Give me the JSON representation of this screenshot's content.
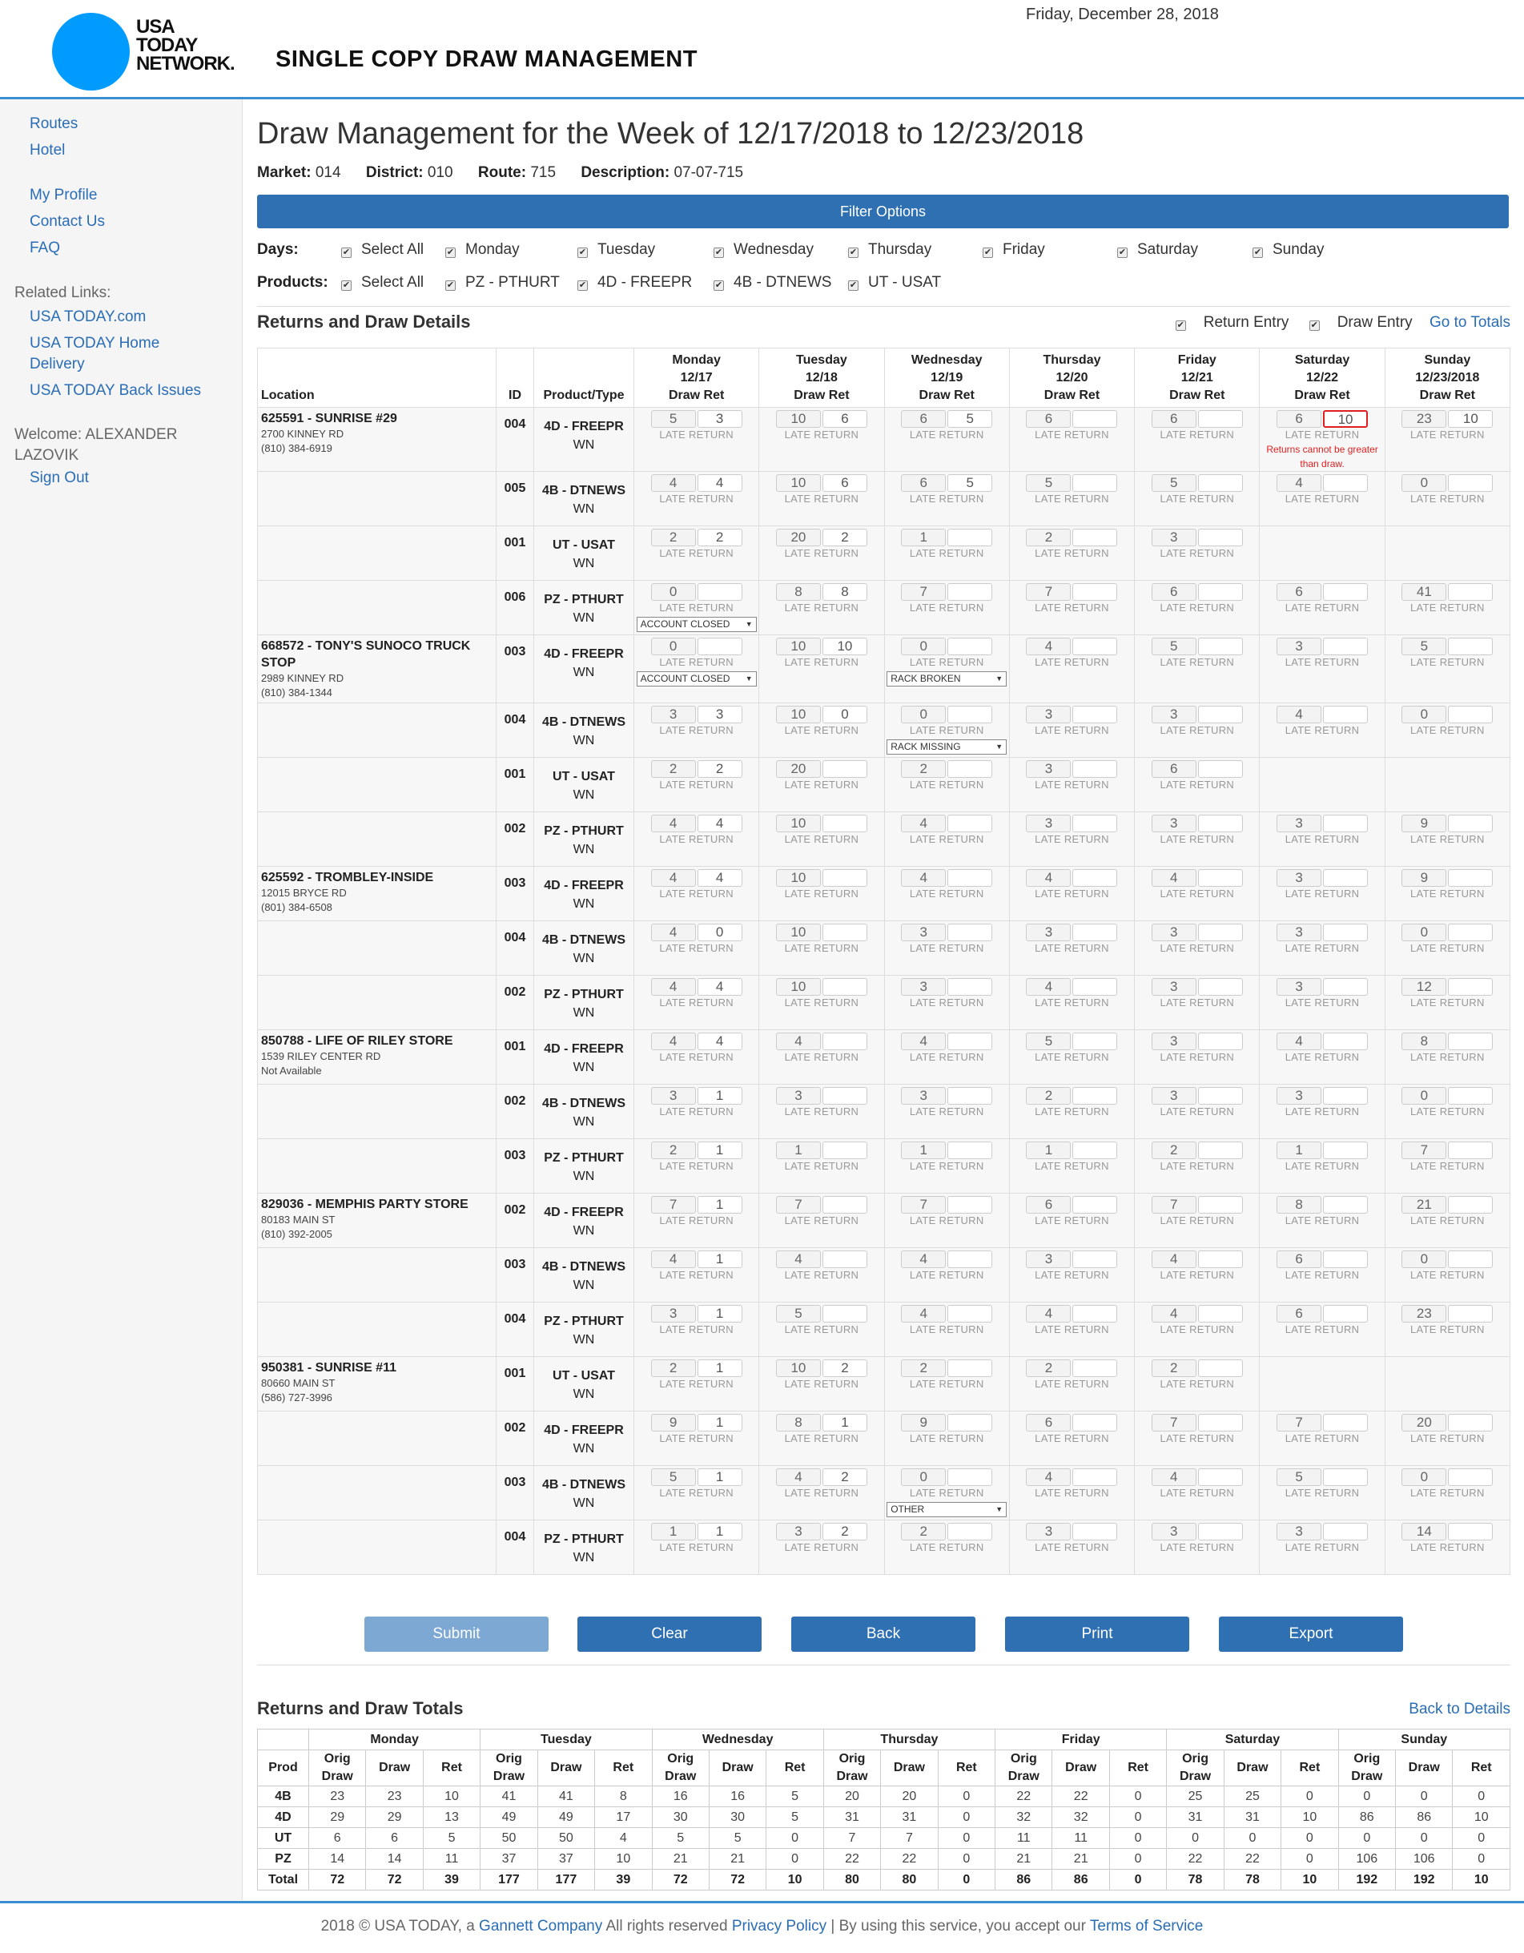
{
  "header": {
    "logo_line1": "USA",
    "logo_line2": "TODAY",
    "logo_line3": "NETWORK.",
    "app_title": "SINGLE COPY DRAW MANAGEMENT",
    "date": "Friday, December 28, 2018"
  },
  "sidebar": {
    "routes": "Routes",
    "hotel": "Hotel",
    "my_profile": "My Profile",
    "contact_us": "Contact Us",
    "faq": "FAQ",
    "related_links": "Related Links:",
    "link_usatoday": "USA TODAY.com",
    "link_home_delivery": "USA TODAY Home Delivery",
    "link_back_issues": "USA TODAY Back Issues",
    "welcome": "Welcome: ALEXANDER LAZOVIK",
    "sign_out": "Sign Out"
  },
  "main": {
    "title": "Draw Management for the Week of 12/17/2018 to 12/23/2018",
    "market_label": "Market:",
    "market": "014",
    "district_label": "District:",
    "district": "010",
    "route_label": "Route:",
    "route": "715",
    "description_label": "Description:",
    "description": "07-07-715",
    "filter_options": "Filter Options",
    "days_label": "Days:",
    "products_label": "Products:",
    "days": [
      "Select All",
      "Monday",
      "Tuesday",
      "Wednesday",
      "Thursday",
      "Friday",
      "Saturday",
      "Sunday"
    ],
    "products": [
      "Select All",
      "PZ - PTHURT",
      "4D - FREEPR",
      "4B - DTNEWS",
      "UT - USAT"
    ],
    "details_title": "Returns and Draw Details",
    "return_entry": "Return Entry",
    "draw_entry": "Draw Entry",
    "go_to_totals": "Go to Totals",
    "col_location": "Location",
    "col_id": "ID",
    "col_product": "Product/Type",
    "day_headers": [
      [
        "Monday",
        "12/17",
        "Draw Ret"
      ],
      [
        "Tuesday",
        "12/18",
        "Draw Ret"
      ],
      [
        "Wednesday",
        "12/19",
        "Draw Ret"
      ],
      [
        "Thursday",
        "12/20",
        "Draw Ret"
      ],
      [
        "Friday",
        "12/21",
        "Draw Ret"
      ],
      [
        "Saturday",
        "12/22",
        "Draw Ret"
      ],
      [
        "Sunday",
        "12/23/2018",
        "Draw Ret"
      ]
    ],
    "late_return": "LATE RETURN",
    "error_msg": "Returns cannot be greater than draw.",
    "buttons": {
      "submit": "Submit",
      "clear": "Clear",
      "back": "Back",
      "print": "Print",
      "export": "Export"
    },
    "totals_title": "Returns and Draw Totals",
    "back_to_details": "Back to Details"
  },
  "rows": [
    {
      "loc": "625591 - SUNRISE #29",
      "addr": "2700 KINNEY RD",
      "phone": "(810) 384-6919",
      "id": "004",
      "prod": "4D - FREEPR",
      "type": "WN",
      "days": [
        [
          "5",
          "3"
        ],
        [
          "10",
          "6"
        ],
        [
          "6",
          "5"
        ],
        [
          "6",
          ""
        ],
        [
          "6",
          ""
        ],
        [
          "6",
          "10",
          "err"
        ],
        [
          "23",
          "10"
        ]
      ]
    },
    {
      "id": "005",
      "prod": "4B - DTNEWS",
      "type": "WN",
      "days": [
        [
          "4",
          "4"
        ],
        [
          "10",
          "6"
        ],
        [
          "6",
          "5"
        ],
        [
          "5",
          ""
        ],
        [
          "5",
          ""
        ],
        [
          "4",
          ""
        ],
        [
          "0",
          ""
        ]
      ]
    },
    {
      "id": "001",
      "prod": "UT - USAT",
      "type": "WN",
      "days": [
        [
          "2",
          "2"
        ],
        [
          "20",
          "2"
        ],
        [
          "1",
          ""
        ],
        [
          "2",
          ""
        ],
        [
          "3",
          ""
        ],
        null,
        null
      ]
    },
    {
      "id": "006",
      "prod": "PZ - PTHURT",
      "type": "WN",
      "days": [
        [
          "0",
          "",
          "ACCOUNT CLOSED"
        ],
        [
          "8",
          "8"
        ],
        [
          "7",
          ""
        ],
        [
          "7",
          ""
        ],
        [
          "6",
          ""
        ],
        [
          "6",
          ""
        ],
        [
          "41",
          ""
        ]
      ]
    },
    {
      "loc": "668572 - TONY'S SUNOCO TRUCK STOP",
      "addr": "2989 KINNEY RD",
      "phone": "(810) 384-1344",
      "id": "003",
      "prod": "4D - FREEPR",
      "type": "WN",
      "days": [
        [
          "0",
          "",
          "ACCOUNT CLOSED"
        ],
        [
          "10",
          "10"
        ],
        [
          "0",
          "",
          "RACK BROKEN"
        ],
        [
          "4",
          ""
        ],
        [
          "5",
          ""
        ],
        [
          "3",
          ""
        ],
        [
          "5",
          ""
        ]
      ]
    },
    {
      "id": "004",
      "prod": "4B - DTNEWS",
      "type": "WN",
      "days": [
        [
          "3",
          "3"
        ],
        [
          "10",
          "0"
        ],
        [
          "0",
          "",
          "RACK MISSING"
        ],
        [
          "3",
          ""
        ],
        [
          "3",
          ""
        ],
        [
          "4",
          ""
        ],
        [
          "0",
          ""
        ]
      ]
    },
    {
      "id": "001",
      "prod": "UT - USAT",
      "type": "WN",
      "days": [
        [
          "2",
          "2"
        ],
        [
          "20",
          ""
        ],
        [
          "2",
          ""
        ],
        [
          "3",
          ""
        ],
        [
          "6",
          ""
        ],
        null,
        null
      ]
    },
    {
      "id": "002",
      "prod": "PZ - PTHURT",
      "type": "WN",
      "days": [
        [
          "4",
          "4"
        ],
        [
          "10",
          ""
        ],
        [
          "4",
          ""
        ],
        [
          "3",
          ""
        ],
        [
          "3",
          ""
        ],
        [
          "3",
          ""
        ],
        [
          "9",
          ""
        ]
      ]
    },
    {
      "loc": "625592 - TROMBLEY-INSIDE",
      "addr": "12015 BRYCE RD",
      "phone": "(801) 384-6508",
      "id": "003",
      "prod": "4D - FREEPR",
      "type": "WN",
      "days": [
        [
          "4",
          "4"
        ],
        [
          "10",
          ""
        ],
        [
          "4",
          ""
        ],
        [
          "4",
          ""
        ],
        [
          "4",
          ""
        ],
        [
          "3",
          ""
        ],
        [
          "9",
          ""
        ]
      ]
    },
    {
      "id": "004",
      "prod": "4B - DTNEWS",
      "type": "WN",
      "days": [
        [
          "4",
          "0"
        ],
        [
          "10",
          ""
        ],
        [
          "3",
          ""
        ],
        [
          "3",
          ""
        ],
        [
          "3",
          ""
        ],
        [
          "3",
          ""
        ],
        [
          "0",
          ""
        ]
      ]
    },
    {
      "id": "002",
      "prod": "PZ - PTHURT",
      "type": "WN",
      "days": [
        [
          "4",
          "4"
        ],
        [
          "10",
          ""
        ],
        [
          "3",
          ""
        ],
        [
          "4",
          ""
        ],
        [
          "3",
          ""
        ],
        [
          "3",
          ""
        ],
        [
          "12",
          ""
        ]
      ]
    },
    {
      "loc": "850788 - LIFE OF RILEY STORE",
      "addr": "1539 RILEY CENTER RD",
      "phone": "Not Available",
      "id": "001",
      "prod": "4D - FREEPR",
      "type": "WN",
      "days": [
        [
          "4",
          "4"
        ],
        [
          "4",
          ""
        ],
        [
          "4",
          ""
        ],
        [
          "5",
          ""
        ],
        [
          "3",
          ""
        ],
        [
          "4",
          ""
        ],
        [
          "8",
          ""
        ]
      ]
    },
    {
      "id": "002",
      "prod": "4B - DTNEWS",
      "type": "WN",
      "days": [
        [
          "3",
          "1"
        ],
        [
          "3",
          ""
        ],
        [
          "3",
          ""
        ],
        [
          "2",
          ""
        ],
        [
          "3",
          ""
        ],
        [
          "3",
          ""
        ],
        [
          "0",
          ""
        ]
      ]
    },
    {
      "id": "003",
      "prod": "PZ - PTHURT",
      "type": "WN",
      "days": [
        [
          "2",
          "1"
        ],
        [
          "1",
          ""
        ],
        [
          "1",
          ""
        ],
        [
          "1",
          ""
        ],
        [
          "2",
          ""
        ],
        [
          "1",
          ""
        ],
        [
          "7",
          ""
        ]
      ]
    },
    {
      "loc": "829036 - MEMPHIS PARTY STORE",
      "addr": "80183 MAIN ST",
      "phone": "(810) 392-2005",
      "id": "002",
      "prod": "4D - FREEPR",
      "type": "WN",
      "days": [
        [
          "7",
          "1"
        ],
        [
          "7",
          ""
        ],
        [
          "7",
          ""
        ],
        [
          "6",
          ""
        ],
        [
          "7",
          ""
        ],
        [
          "8",
          ""
        ],
        [
          "21",
          ""
        ]
      ]
    },
    {
      "id": "003",
      "prod": "4B - DTNEWS",
      "type": "WN",
      "days": [
        [
          "4",
          "1"
        ],
        [
          "4",
          ""
        ],
        [
          "4",
          ""
        ],
        [
          "3",
          ""
        ],
        [
          "4",
          ""
        ],
        [
          "6",
          ""
        ],
        [
          "0",
          ""
        ]
      ]
    },
    {
      "id": "004",
      "prod": "PZ - PTHURT",
      "type": "WN",
      "days": [
        [
          "3",
          "1"
        ],
        [
          "5",
          ""
        ],
        [
          "4",
          ""
        ],
        [
          "4",
          ""
        ],
        [
          "4",
          ""
        ],
        [
          "6",
          ""
        ],
        [
          "23",
          ""
        ]
      ]
    },
    {
      "loc": "950381 - SUNRISE #11",
      "addr": "80660 MAIN ST",
      "phone": "(586) 727-3996",
      "id": "001",
      "prod": "UT - USAT",
      "type": "WN",
      "days": [
        [
          "2",
          "1"
        ],
        [
          "10",
          "2"
        ],
        [
          "2",
          ""
        ],
        [
          "2",
          ""
        ],
        [
          "2",
          ""
        ],
        null,
        null
      ]
    },
    {
      "id": "002",
      "prod": "4D - FREEPR",
      "type": "WN",
      "days": [
        [
          "9",
          "1"
        ],
        [
          "8",
          "1"
        ],
        [
          "9",
          ""
        ],
        [
          "6",
          ""
        ],
        [
          "7",
          ""
        ],
        [
          "7",
          ""
        ],
        [
          "20",
          ""
        ]
      ]
    },
    {
      "id": "003",
      "prod": "4B - DTNEWS",
      "type": "WN",
      "days": [
        [
          "5",
          "1"
        ],
        [
          "4",
          "2"
        ],
        [
          "0",
          "",
          "OTHER"
        ],
        [
          "4",
          ""
        ],
        [
          "4",
          ""
        ],
        [
          "5",
          ""
        ],
        [
          "0",
          ""
        ]
      ]
    },
    {
      "id": "004",
      "prod": "PZ - PTHURT",
      "type": "WN",
      "days": [
        [
          "1",
          "1"
        ],
        [
          "3",
          "2"
        ],
        [
          "2",
          ""
        ],
        [
          "3",
          ""
        ],
        [
          "3",
          ""
        ],
        [
          "3",
          ""
        ],
        [
          "14",
          ""
        ]
      ]
    }
  ],
  "totals": {
    "days": [
      "Monday",
      "Tuesday",
      "Wednesday",
      "Thursday",
      "Friday",
      "Saturday",
      "Sunday"
    ],
    "subheaders": [
      "Prod",
      "Orig Draw",
      "Draw",
      "Ret"
    ],
    "rows": [
      {
        "prod": "4B",
        "vals": [
          "23",
          "23",
          "10",
          "41",
          "41",
          "8",
          "16",
          "16",
          "5",
          "20",
          "20",
          "0",
          "22",
          "22",
          "0",
          "25",
          "25",
          "0",
          "0",
          "0",
          "0"
        ]
      },
      {
        "prod": "4D",
        "vals": [
          "29",
          "29",
          "13",
          "49",
          "49",
          "17",
          "30",
          "30",
          "5",
          "31",
          "31",
          "0",
          "32",
          "32",
          "0",
          "31",
          "31",
          "10",
          "86",
          "86",
          "10"
        ]
      },
      {
        "prod": "UT",
        "vals": [
          "6",
          "6",
          "5",
          "50",
          "50",
          "4",
          "5",
          "5",
          "0",
          "7",
          "7",
          "0",
          "11",
          "11",
          "0",
          "0",
          "0",
          "0",
          "0",
          "0",
          "0"
        ]
      },
      {
        "prod": "PZ",
        "vals": [
          "14",
          "14",
          "11",
          "37",
          "37",
          "10",
          "21",
          "21",
          "0",
          "22",
          "22",
          "0",
          "21",
          "21",
          "0",
          "22",
          "22",
          "0",
          "106",
          "106",
          "0"
        ]
      },
      {
        "prod": "Total",
        "vals": [
          "72",
          "72",
          "39",
          "177",
          "177",
          "39",
          "72",
          "72",
          "10",
          "80",
          "80",
          "0",
          "86",
          "86",
          "0",
          "78",
          "78",
          "10",
          "192",
          "192",
          "10"
        ]
      }
    ]
  },
  "footer": {
    "prefix": "2018 © USA TODAY, a ",
    "gannett": "Gannett Company",
    "mid": " All rights reserved ",
    "privacy": "Privacy Policy",
    "mid2": " | By using this service, you accept our ",
    "terms": "Terms of Service"
  }
}
